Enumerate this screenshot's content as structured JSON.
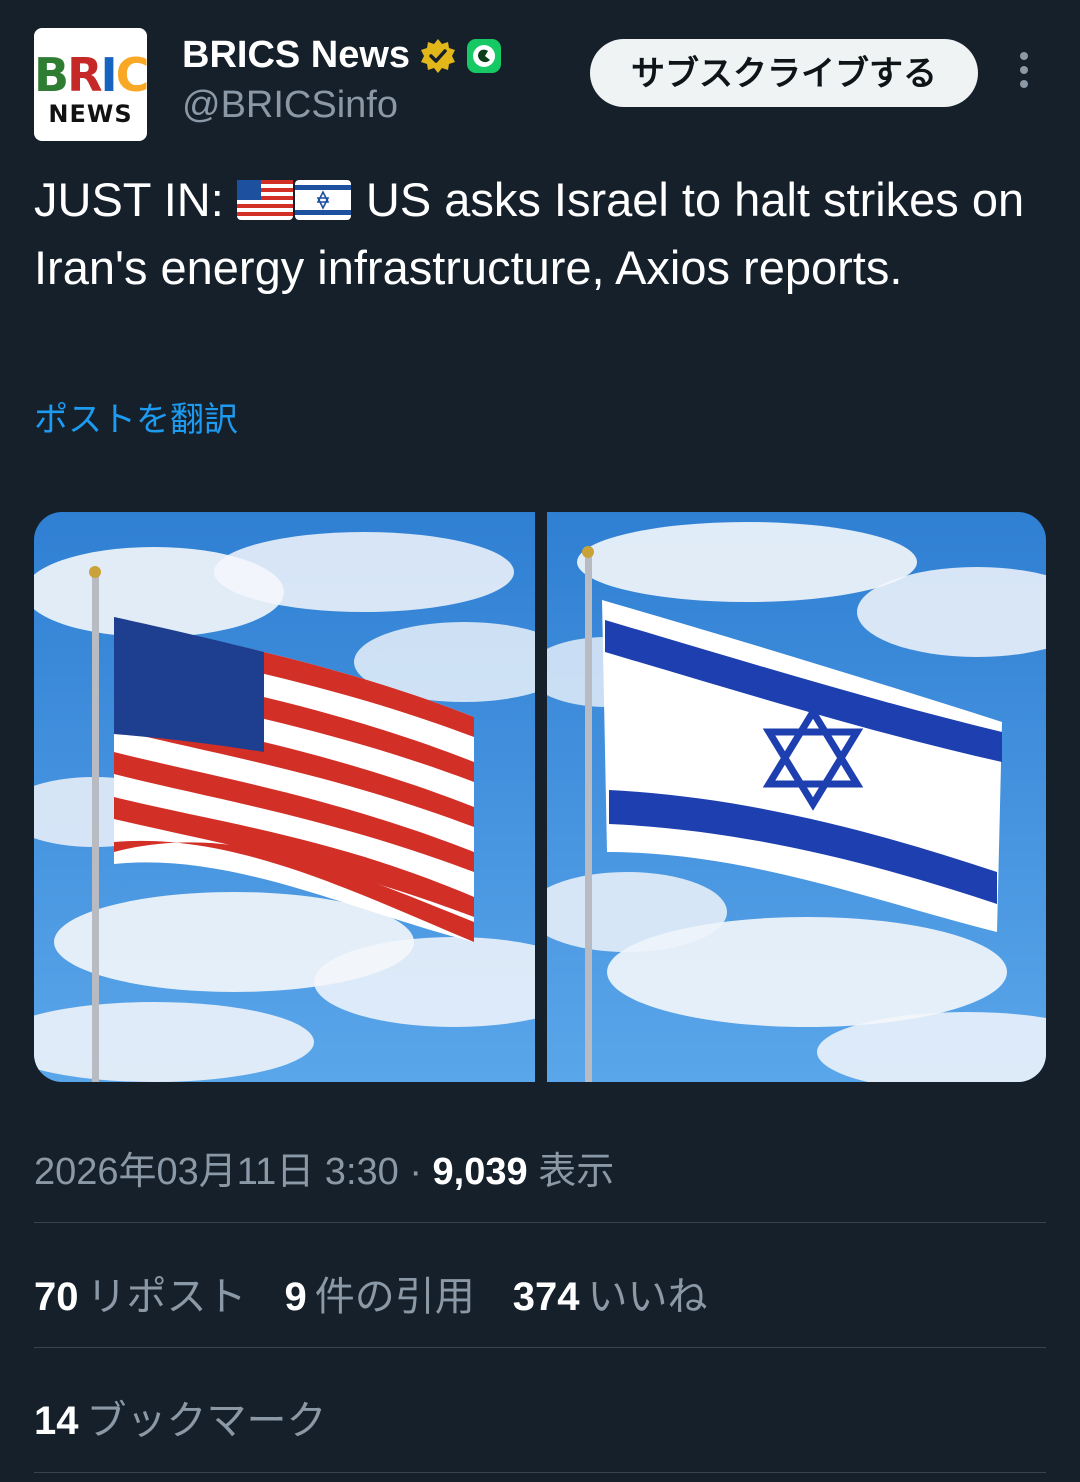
{
  "post": {
    "author_name": "BRICS News",
    "author_handle": "@BRICSinfo",
    "avatar_text_top": "BRICS",
    "avatar_text_bottom": "NEWS",
    "subscribe_label": "サブスクライブする",
    "text_prefix": "JUST IN: ",
    "text_body": " US asks Israel to halt strikes on Iran's energy infrastructure, Axios reports.",
    "translate_label": "ポストを翻訳",
    "timestamp": "2026年03月11日 3:30 · ",
    "views_count": "9,039",
    "views_label": " 表示",
    "reposts_count": "70",
    "reposts_label": "リポスト",
    "quotes_count": "9",
    "quotes_label": "件の引用",
    "likes_count": "374",
    "likes_label": "いいね",
    "bookmarks_count": "14",
    "bookmarks_label": "ブックマーク"
  },
  "icons": {
    "verified": "verified-badge-icon",
    "affiliate": "affiliate-badge-icon",
    "more": "more-vertical-icon"
  },
  "colors": {
    "background": "#15202b",
    "link": "#1d9bf0",
    "muted": "#8b98a5",
    "verified_gold": "#e2b719",
    "affiliate_green": "#17c964"
  }
}
